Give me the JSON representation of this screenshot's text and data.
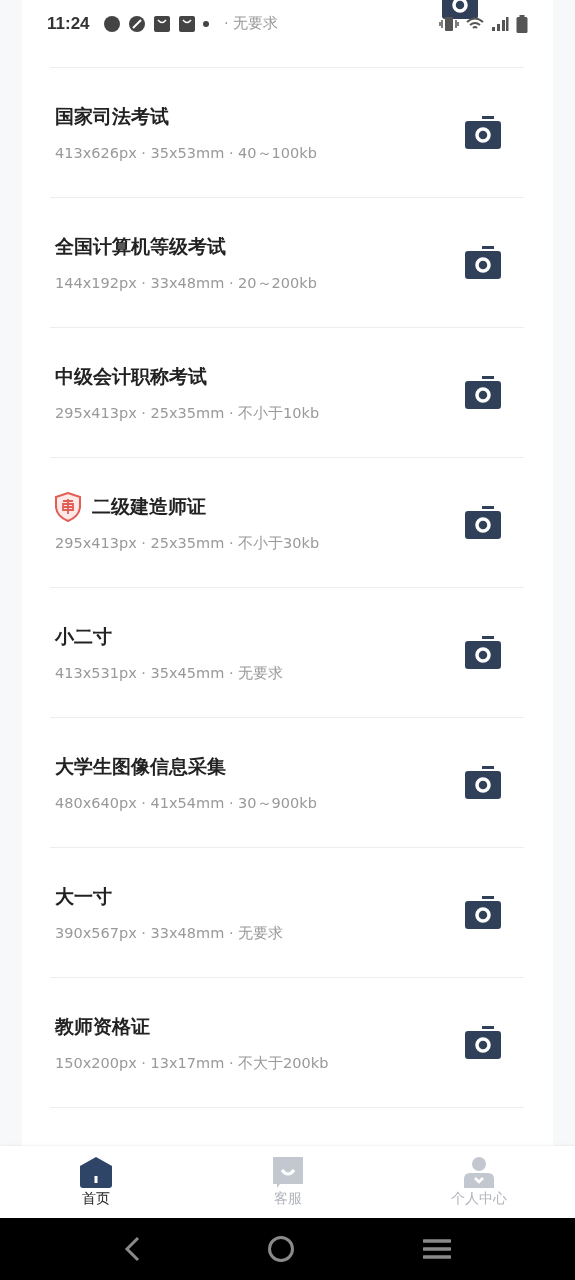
{
  "status_bar": {
    "time": "11:24"
  },
  "partial_item": {
    "spec": "· 无要求"
  },
  "items": [
    {
      "title": "国家司法考试",
      "spec": "413x626px · 35x53mm · 40～100kb",
      "verified": false
    },
    {
      "title": "全国计算机等级考试",
      "spec": "144x192px · 33x48mm · 20～200kb",
      "verified": false
    },
    {
      "title": "中级会计职称考试",
      "spec": "295x413px · 25x35mm · 不小于10kb",
      "verified": false
    },
    {
      "title": "二级建造师证",
      "spec": "295x413px · 25x35mm · 不小于30kb",
      "verified": true
    },
    {
      "title": "小二寸",
      "spec": "413x531px · 35x45mm · 无要求",
      "verified": false
    },
    {
      "title": "大学生图像信息采集",
      "spec": "480x640px · 41x54mm · 30～900kb",
      "verified": false
    },
    {
      "title": "大一寸",
      "spec": "390x567px · 33x48mm · 无要求",
      "verified": false
    },
    {
      "title": "教师资格证",
      "spec": "150x200px · 13x17mm · 不大于200kb",
      "verified": false
    }
  ],
  "tabs": [
    {
      "kind": "home",
      "label": "首页",
      "selected": true
    },
    {
      "kind": "service",
      "label": "客服",
      "selected": false
    },
    {
      "kind": "profile",
      "label": "个人中心",
      "selected": false
    }
  ]
}
